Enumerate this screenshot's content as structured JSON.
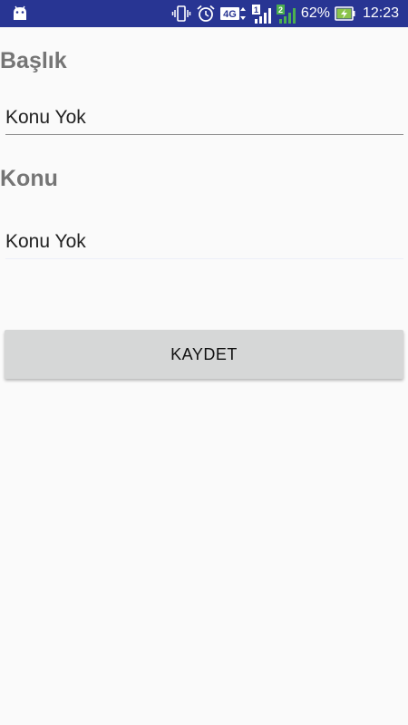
{
  "status_bar": {
    "battery_percent": "62%",
    "time": "12:23",
    "network_type": "4G",
    "sim1_label": "1",
    "sim2_label": "2",
    "background_color": "#283593",
    "icons": [
      "android-icon",
      "vibrate-icon",
      "alarm-icon",
      "network-4g-icon",
      "signal-sim1-icon",
      "signal-sim2-icon",
      "battery-charging-icon"
    ]
  },
  "form": {
    "title_label": "Başlık",
    "title_value": "Konu Yok",
    "topic_label": "Konu",
    "topic_value": "Konu Yok",
    "save_label": "KAYDET"
  },
  "colors": {
    "label": "#757575",
    "button_bg": "#d6d7d7",
    "page_bg": "#fafafa",
    "signal_green": "#4caf50",
    "battery_green": "#8bc34a"
  }
}
